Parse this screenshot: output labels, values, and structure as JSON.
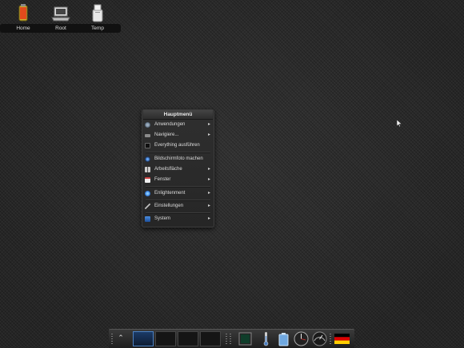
{
  "desktop": {
    "icons": [
      {
        "label": "Home",
        "icon": "home-folder-icon"
      },
      {
        "label": "Root",
        "icon": "root-drive-icon"
      },
      {
        "label": "Temp",
        "icon": "temp-folder-icon"
      }
    ]
  },
  "menu": {
    "title": "Hauptmenü",
    "items": [
      {
        "label": "Anwendungen",
        "icon": "applications-icon",
        "submenu": true
      },
      {
        "label": "Navigiere...",
        "icon": "navigate-icon",
        "submenu": true
      },
      {
        "label": "Everything ausführen",
        "icon": "run-everything-icon",
        "submenu": false
      },
      {
        "label": "Bildschirmfoto machen",
        "icon": "screenshot-icon",
        "submenu": false
      },
      {
        "label": "Arbeitsfläche",
        "icon": "desktop-icon",
        "submenu": true
      },
      {
        "label": "Fenster",
        "icon": "windows-icon",
        "submenu": true
      },
      {
        "label": "Enlightenment",
        "icon": "enlightenment-icon",
        "submenu": true
      },
      {
        "label": "Einstellungen",
        "icon": "settings-icon",
        "submenu": true
      },
      {
        "label": "System",
        "icon": "system-icon",
        "submenu": true
      }
    ],
    "submenu_arrow": "▸"
  },
  "shelf": {
    "start_glyph": "⌃",
    "pager_active": 0,
    "gadgets": [
      "terminal-icon",
      "thermometer-icon",
      "battery-icon",
      "clock-icon",
      "cpufreq-gauge-icon",
      "german-flag-icon"
    ]
  },
  "colors": {
    "accent": "#4a7fc1",
    "flag": [
      "#000000",
      "#dd0000",
      "#ffce00"
    ]
  }
}
